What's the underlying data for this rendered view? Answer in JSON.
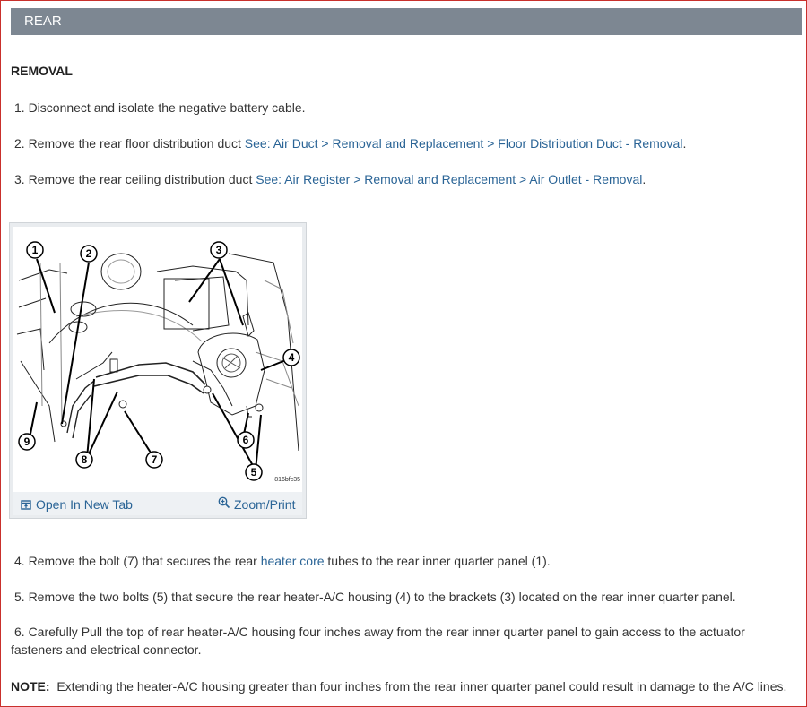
{
  "section": {
    "title": "REAR"
  },
  "removal": {
    "heading": "REMOVAL"
  },
  "steps": {
    "s1": {
      "text": "1. Disconnect and isolate the negative battery cable."
    },
    "s2": {
      "text": "2. Remove the rear floor distribution duct ",
      "link": "See: Air Duct > Removal and Replacement > Floor Distribution Duct - Removal",
      "tail": "."
    },
    "s3": {
      "text": "3. Remove the rear ceiling distribution duct ",
      "link": "See: Air Register > Removal and Replacement > Air Outlet - Removal",
      "tail": "."
    },
    "s4": {
      "pre": "4. Remove the bolt (7) that secures the rear ",
      "link": "heater core",
      "post": " tubes to the rear inner quarter panel (1)."
    },
    "s5": {
      "text": "5. Remove the two bolts (5) that secure the rear heater-A/C housing (4) to the brackets (3) located on the rear inner quarter panel."
    },
    "s6": {
      "text": "6. Carefully Pull the top of rear heater-A/C housing four inches away from the rear inner quarter panel to gain access to the actuator fasteners and electrical connector."
    }
  },
  "note": {
    "label": "NOTE:",
    "text": "Extending the heater-A/C housing greater than four inches from the rear inner quarter panel could result in damage to the A/C lines."
  },
  "figure": {
    "code": "816bfc35",
    "open_tab": "Open In New Tab",
    "zoom": "Zoom/Print",
    "callouts": [
      "1",
      "2",
      "3",
      "4",
      "5",
      "6",
      "7",
      "8",
      "9"
    ]
  },
  "colors": {
    "banner": "#7d8792",
    "link": "#2a6496",
    "border": "#c9302c"
  }
}
